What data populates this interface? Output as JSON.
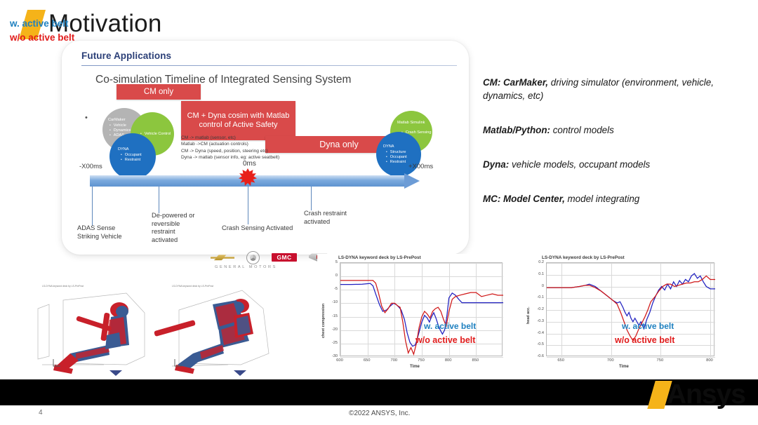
{
  "slide": {
    "title": "Motivation",
    "page_number": "4",
    "copyright": "©2022 ANSYS, Inc.",
    "brand": "Ansys",
    "accent_color": "#f5b319"
  },
  "card": {
    "heading": "Future Applications",
    "bullet_glyph": "•",
    "subtitle": "Co-simulation Timeline of Integrated Sensing System"
  },
  "banners": [
    {
      "label": "CM only",
      "color": "#d94a4a"
    },
    {
      "label": "CM + Dyna cosim with Matlab control of Active Safety",
      "color": "#d94a4a"
    },
    {
      "label": "Dyna only",
      "color": "#d94a4a"
    }
  ],
  "circles": [
    {
      "name": "CarMaker",
      "items": [
        "Vehicle",
        "Dynamics",
        "ADAS"
      ],
      "color": "#b4b4b4"
    },
    {
      "name": "",
      "items": [
        "Vehicle Control"
      ],
      "color": "#8cc63e"
    },
    {
      "name": "DYNA",
      "items": [
        "Occupant",
        "Restraint"
      ],
      "color": "#1f70c1"
    },
    {
      "name": "Matlab Simulink",
      "items": [
        "Crash Sensing"
      ],
      "color": "#8cc63e"
    },
    {
      "name": "DYNA",
      "items": [
        "Structure",
        "Occupant",
        "Restraint"
      ],
      "color": "#1f70c1"
    }
  ],
  "cosim_lines": [
    "CM -> matlab (sensor, etc)",
    "Matlab ->CM (actuation controls)",
    "CM -> Dyna (speed, position, steering etc)",
    "Dyna -> matlab (sensor info, eg: active seatbelt)"
  ],
  "timeline": {
    "left_label": "-X00ms",
    "zero_label": "0ms",
    "right_label": "+X00ms",
    "events": [
      "ADAS Sense Striking Vehicle",
      "De-powered or reversible restraint activated",
      "Crash Sensing Activated",
      "Crash restraint activated"
    ]
  },
  "gm": {
    "wordmark": "GENERAL MOTORS",
    "brands": [
      "Chevrolet",
      "Buick",
      "GMC",
      "Cadillac"
    ],
    "gmc_text": "GMC"
  },
  "legend": [
    {
      "bold": "CM: CarMaker,",
      "rest": " driving simulator (environment, vehicle, dynamics, etc)"
    },
    {
      "bold": "Matlab/Python:",
      "rest": " control models"
    },
    {
      "bold": "Dyna:",
      "rest": " vehicle models, occupant models"
    },
    {
      "bold": "MC: Model Center,",
      "rest": " model integrating"
    }
  ],
  "sim_panels": {
    "header_text": "LS-DYNA keyword deck by LS-PrePost",
    "label_with": "w. active belt",
    "label_without": "w/o active belt",
    "color_with": "#1f81c0",
    "color_without": "#e01b1b"
  },
  "chart_data": [
    {
      "type": "line",
      "title": "LS-DYNA keyword deck by LS-PrePost",
      "xlabel": "Time",
      "ylabel": "chest compression",
      "xlim": [
        600,
        900
      ],
      "ylim": [
        -30,
        5
      ],
      "xticks": [
        600,
        650,
        700,
        750,
        800,
        850
      ],
      "yticks": [
        5,
        0,
        -5,
        -10,
        -15,
        -20,
        -25,
        -30
      ],
      "grid": true,
      "legend": [
        "w. active belt",
        "w/o active belt"
      ],
      "legend_position": "inside-bottom-right",
      "series": [
        {
          "name": "w. active belt",
          "color": "#2020c0",
          "x": [
            600,
            620,
            640,
            655,
            660,
            665,
            672,
            678,
            685,
            692,
            698,
            703,
            708,
            712,
            718,
            723,
            728,
            733,
            738,
            742,
            746,
            750,
            755,
            760,
            764,
            768,
            772,
            776,
            780,
            784,
            788,
            792,
            796,
            800,
            806,
            812,
            818,
            824,
            830,
            840,
            850,
            860,
            870,
            880,
            890,
            900
          ],
          "y": [
            -3.0,
            -3.0,
            -2.9,
            -2.6,
            -3.5,
            -6.5,
            -10.5,
            -13.0,
            -12.5,
            -11.0,
            -10.0,
            -10.5,
            -11.5,
            -12.5,
            -16.0,
            -21.0,
            -24.5,
            -26.0,
            -25.5,
            -23.0,
            -20.0,
            -17.0,
            -14.5,
            -15.5,
            -17.0,
            -15.0,
            -13.5,
            -15.5,
            -18.0,
            -20.0,
            -21.5,
            -20.0,
            -15.0,
            -8.0,
            -6.2,
            -7.0,
            -8.5,
            -9.8,
            -9.8,
            -9.8,
            -9.8,
            -9.8,
            -9.8,
            -9.8,
            -9.8,
            -9.8
          ]
        },
        {
          "name": "w/o active belt",
          "color": "#d01818",
          "x": [
            600,
            620,
            640,
            655,
            660,
            665,
            670,
            676,
            682,
            688,
            694,
            700,
            706,
            710,
            715,
            720,
            725,
            730,
            735,
            740,
            745,
            750,
            755,
            760,
            765,
            770,
            775,
            780,
            785,
            790,
            795,
            800,
            806,
            812,
            820,
            830,
            840,
            850,
            860,
            870,
            880,
            890,
            900
          ],
          "y": [
            -1.5,
            -1.5,
            -1.5,
            -1.5,
            -1.5,
            -2.5,
            -6.0,
            -11.0,
            -13.5,
            -12.0,
            -10.0,
            -10.0,
            -11.0,
            -11.5,
            -17.0,
            -24.0,
            -28.5,
            -26.5,
            -29.0,
            -25.0,
            -19.0,
            -15.0,
            -13.0,
            -14.0,
            -15.5,
            -13.0,
            -12.0,
            -11.5,
            -13.0,
            -16.0,
            -18.5,
            -13.0,
            -8.5,
            -7.5,
            -7.0,
            -6.5,
            -6.0,
            -6.0,
            -7.5,
            -7.0,
            -6.5,
            -7.0,
            -7.0
          ]
        }
      ]
    },
    {
      "type": "line",
      "title": "LS-DYNA keyword deck by LS-PrePost",
      "xlabel": "Time",
      "ylabel": "head acc.",
      "xlim": [
        635,
        805
      ],
      "ylim": [
        -0.6,
        0.2
      ],
      "xticks": [
        650,
        700,
        750,
        800
      ],
      "yticks": [
        0.2,
        0.1,
        0,
        -0.1,
        -0.2,
        -0.3,
        -0.4,
        -0.5,
        -0.6
      ],
      "grid": true,
      "legend": [
        "w. active belt",
        "w/o active belt"
      ],
      "legend_position": "inside-bottom-right",
      "series": [
        {
          "name": "w. active belt",
          "color": "#2020c0",
          "x": [
            635,
            650,
            660,
            668,
            674,
            678,
            684,
            690,
            696,
            702,
            706,
            709,
            712,
            714,
            716,
            718,
            720,
            722,
            724,
            726,
            728,
            730,
            733,
            736,
            739,
            742,
            745,
            748,
            751,
            754,
            757,
            760,
            763,
            766,
            769,
            772,
            775,
            778,
            781,
            784,
            787,
            790,
            793,
            796,
            800,
            805
          ],
          "y": [
            -0.01,
            -0.01,
            -0.01,
            0.0,
            0.01,
            0.02,
            0.0,
            -0.04,
            -0.08,
            -0.12,
            -0.14,
            -0.13,
            -0.18,
            -0.22,
            -0.25,
            -0.22,
            -0.27,
            -0.3,
            -0.27,
            -0.3,
            -0.33,
            -0.3,
            -0.36,
            -0.28,
            -0.22,
            -0.14,
            -0.08,
            -0.03,
            0.0,
            -0.03,
            0.02,
            -0.02,
            0.04,
            0.0,
            0.05,
            0.02,
            0.06,
            0.04,
            0.09,
            0.11,
            0.07,
            0.09,
            0.04,
            0.0,
            -0.02,
            -0.02
          ]
        },
        {
          "name": "w/o active belt",
          "color": "#d01818",
          "x": [
            635,
            650,
            660,
            668,
            674,
            678,
            684,
            690,
            696,
            702,
            706,
            710,
            713,
            716,
            719,
            722,
            725,
            728,
            731,
            734,
            737,
            740,
            744,
            748,
            752,
            756,
            760,
            764,
            768,
            772,
            776,
            780,
            784,
            788,
            792,
            796,
            800,
            805
          ],
          "y": [
            -0.01,
            -0.01,
            -0.01,
            0.0,
            0.01,
            0.01,
            -0.01,
            -0.04,
            -0.08,
            -0.12,
            -0.15,
            -0.23,
            -0.3,
            -0.37,
            -0.42,
            -0.46,
            -0.42,
            -0.36,
            -0.31,
            -0.26,
            -0.2,
            -0.13,
            -0.09,
            -0.04,
            0.0,
            0.02,
            0.02,
            0.0,
            0.01,
            0.02,
            0.03,
            0.03,
            0.04,
            0.04,
            0.06,
            0.09,
            0.06,
            0.06
          ]
        }
      ]
    }
  ]
}
